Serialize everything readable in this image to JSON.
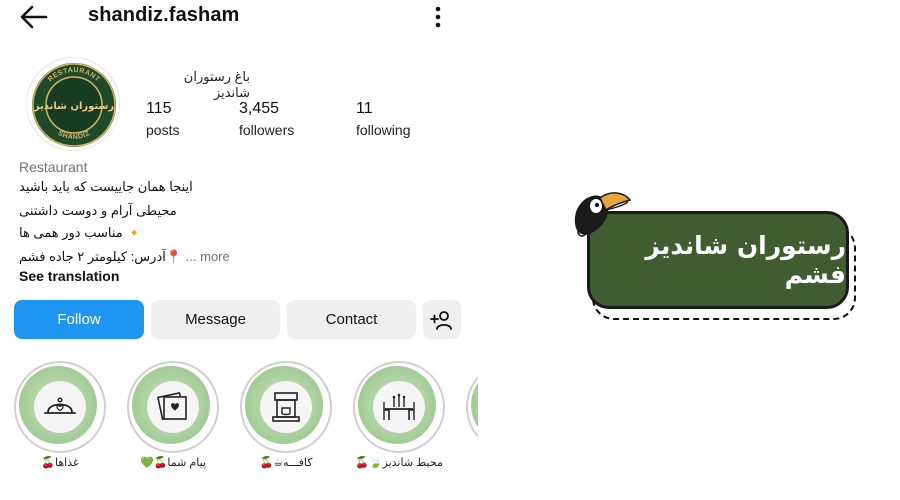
{
  "profile": {
    "username": "shandiz.fasham",
    "display_name": "باغ رستوران شانديز",
    "avatar_text": {
      "center": "رستوران شانديز",
      "ring_top": "RESTAURANT",
      "ring_left": "SHANDIZ"
    },
    "stats": [
      {
        "value": "115",
        "label": "posts"
      },
      {
        "value": "3,455",
        "label": "followers"
      },
      {
        "value": "11",
        "label": "following"
      }
    ],
    "category": "Restaurant",
    "bio": [
      "اينجا همان جاييست که بايد باشيد",
      "محيطی آرام و دوست داشتنی",
      "🔸 مناسب دور همی ها",
      "📍آدرس: کيلومتر ۲ جاده فشم"
    ],
    "more_label": "... more",
    "see_translation": "See translation"
  },
  "actions": {
    "follow": "Follow",
    "message": "Message",
    "contact": "Contact"
  },
  "highlights": [
    {
      "label": "غذاها🍒",
      "icon": "food-cloche-icon"
    },
    {
      "label": "پيام شما🍒💚",
      "icon": "photos-heart-icon"
    },
    {
      "label": "کافـــه☕🍒",
      "icon": "coffee-machine-icon"
    },
    {
      "label": "محيط شانديز🍃🍒",
      "icon": "dining-table-icon"
    },
    {
      "label": "",
      "icon": "partial-highlight-icon"
    }
  ],
  "banner": {
    "text": "رستوران شانديز فشم",
    "icon": "toucan-icon"
  },
  "colors": {
    "follow_button": "#1f95f2",
    "secondary_button": "#efefef",
    "banner_green": "#3f5d31",
    "highlight_green": "#a9cf9c",
    "avatar_green": "#1f4a2a",
    "avatar_gold": "#d3b46a"
  }
}
